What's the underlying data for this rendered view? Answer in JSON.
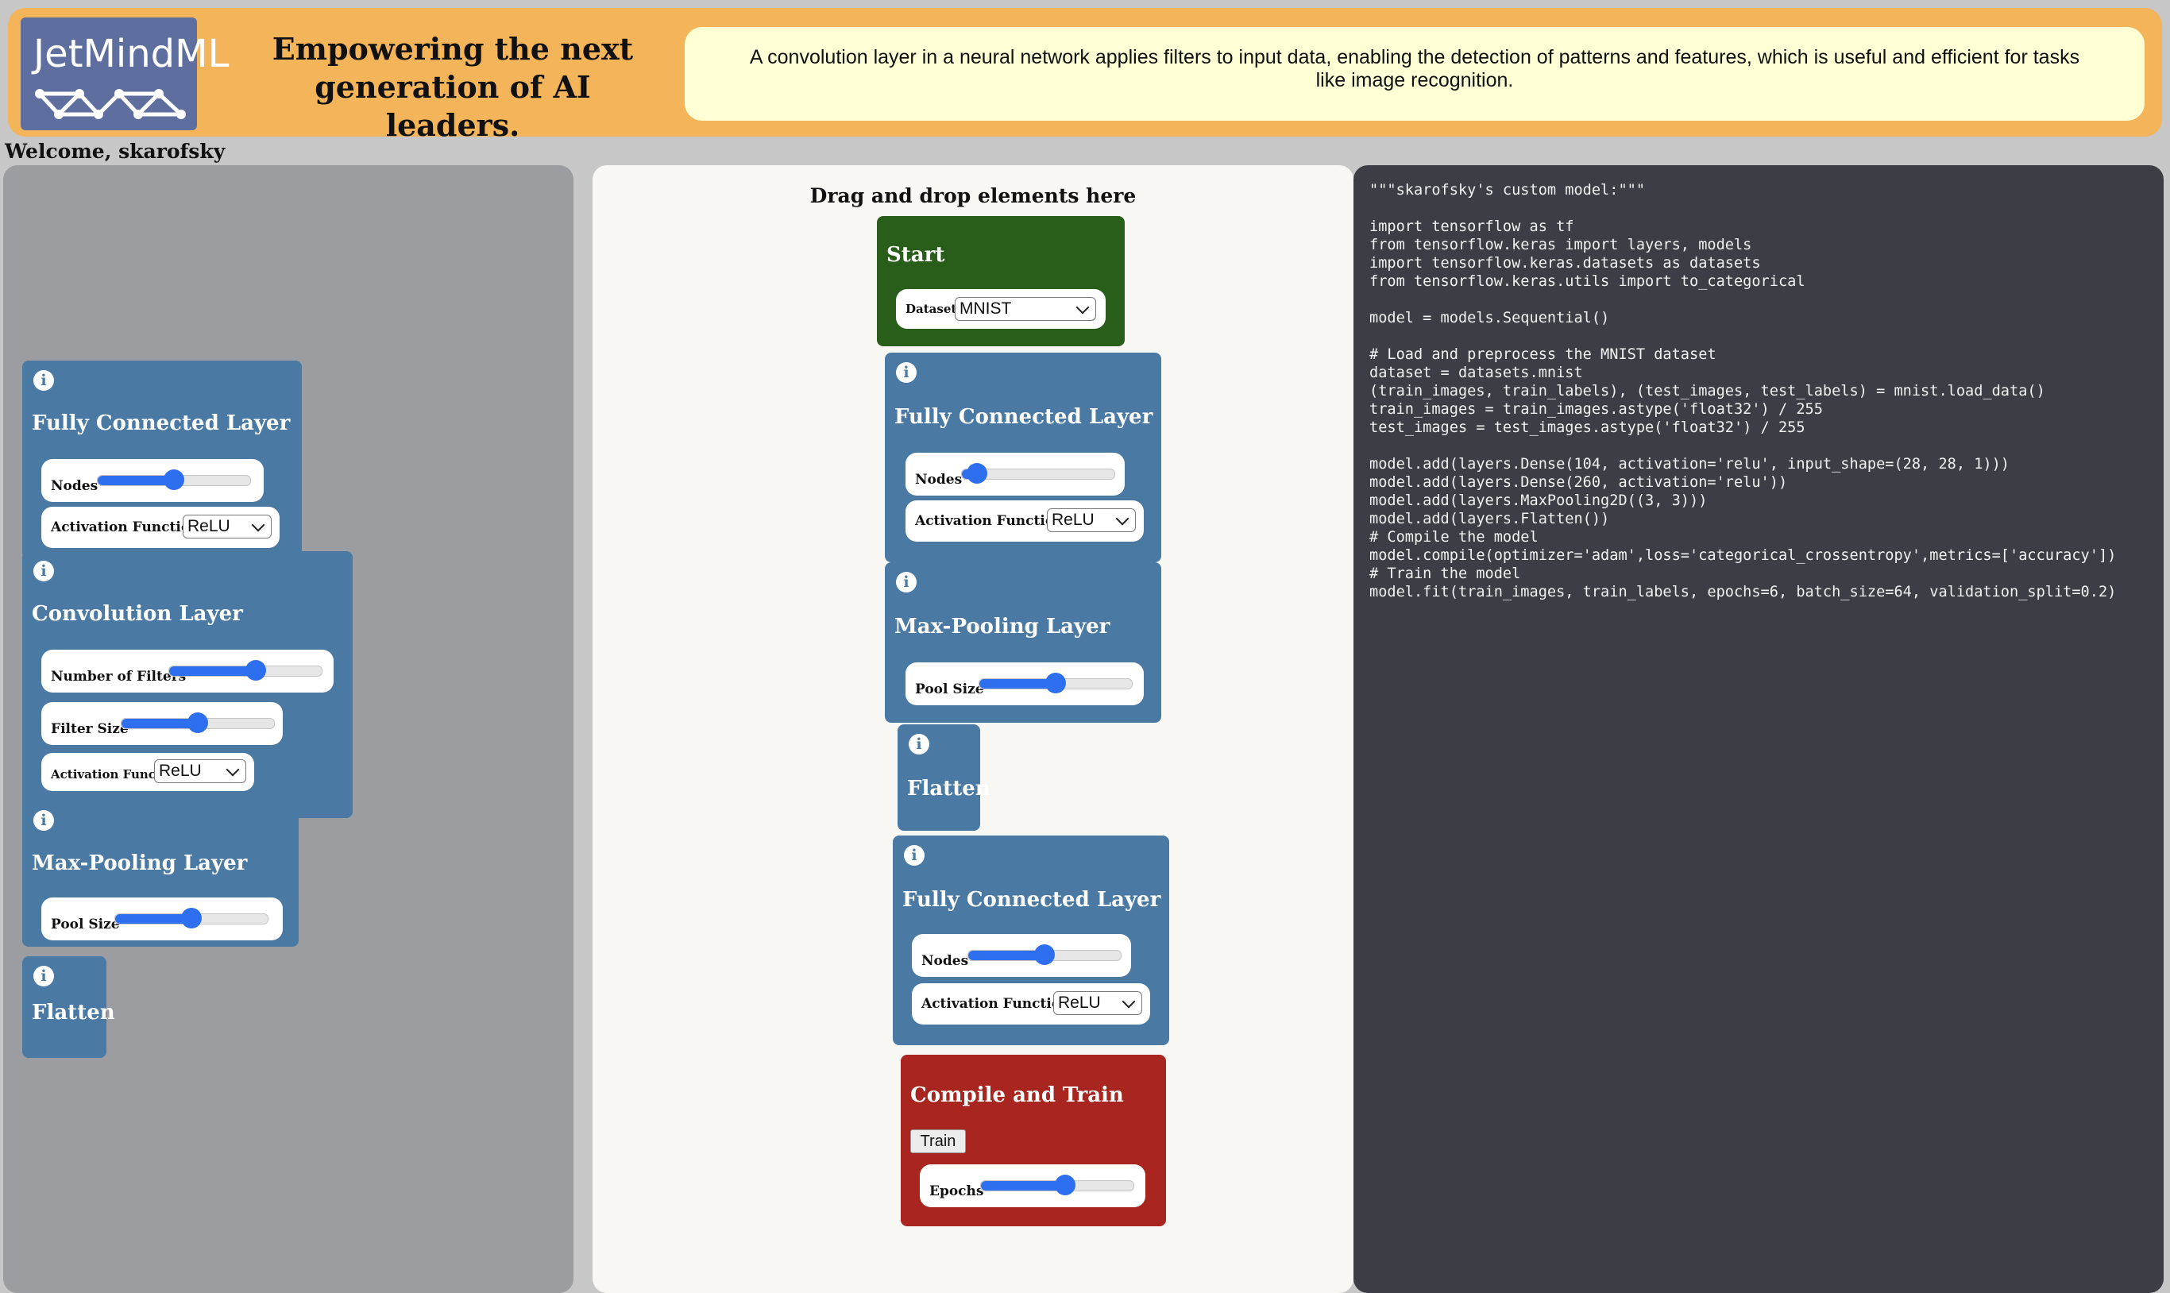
{
  "app": {
    "logo_text": "JetMindML",
    "tagline": "Empowering the next generation of AI leaders.",
    "description": "A convolution layer in a neural network applies filters to input data, enabling the detection of patterns and features, which is useful and efficient for tasks like image recognition.",
    "welcome": "Welcome, skarofsky"
  },
  "palette": {
    "fc": {
      "title": "Fully Connected Layer",
      "nodes_label": "Nodes",
      "nodes_level": 0.5,
      "activation_label": "Activation Function",
      "activation_value": "ReLU"
    },
    "conv": {
      "title": "Convolution Layer",
      "filters_label": "Number of Filters",
      "filters_level": 0.57,
      "filter_size_label": "Filter Size",
      "filter_size_level": 0.5,
      "activation_label": "Activation Function",
      "activation_value": "ReLU"
    },
    "pool": {
      "title": "Max-Pooling Layer",
      "pool_label": "Pool Size",
      "pool_level": 0.5
    },
    "flatten": {
      "title": "Flatten"
    }
  },
  "canvas": {
    "title": "Drag and drop elements here",
    "start": {
      "title": "Start",
      "dataset_label": "Dataset",
      "dataset_value": "MNIST"
    },
    "fc1": {
      "title": "Fully Connected Layer",
      "nodes_label": "Nodes",
      "nodes_level": 0.1,
      "activation_label": "Activation Function",
      "activation_value": "ReLU"
    },
    "pool": {
      "title": "Max-Pooling Layer",
      "pool_label": "Pool Size",
      "pool_level": 0.5
    },
    "flatten": {
      "title": "Flatten"
    },
    "fc2": {
      "title": "Fully Connected Layer",
      "nodes_label": "Nodes",
      "nodes_level": 0.5,
      "activation_label": "Activation Function",
      "activation_value": "ReLU"
    },
    "compile": {
      "title": "Compile and Train",
      "train_label": "Train",
      "epochs_label": "Epochs",
      "epochs_level": 0.55
    }
  },
  "code": {
    "text": "\"\"\"skarofsky's custom model:\"\"\"\n\nimport tensorflow as tf\nfrom tensorflow.keras import layers, models\nimport tensorflow.keras.datasets as datasets\nfrom tensorflow.keras.utils import to_categorical\n\nmodel = models.Sequential()\n\n# Load and preprocess the MNIST dataset\ndataset = datasets.mnist\n(train_images, train_labels), (test_images, test_labels) = mnist.load_data()\ntrain_images = train_images.astype('float32') / 255\ntest_images = test_images.astype('float32') / 255\n\nmodel.add(layers.Dense(104, activation='relu', input_shape=(28, 28, 1)))\nmodel.add(layers.Dense(260, activation='relu'))\nmodel.add(layers.MaxPooling2D((3, 3)))\nmodel.add(layers.Flatten())\n# Compile the model\nmodel.compile(optimizer='adam',loss='categorical_crossentropy',metrics=['accuracy'])\n# Train the model\nmodel.fit(train_images, train_labels, epochs=6, batch_size=64, validation_split=0.2)"
  },
  "icons": {
    "info": "info-icon",
    "chevron": "chevron-down-icon",
    "logo_graph": "network-graph-icon"
  },
  "colors": {
    "header": "#f4b45a",
    "layer_block": "#4a7aa3",
    "start_block": "#285e19",
    "compile_block": "#a8261f",
    "slider": "#2e6ff0",
    "code_bg": "#3c3d45"
  }
}
